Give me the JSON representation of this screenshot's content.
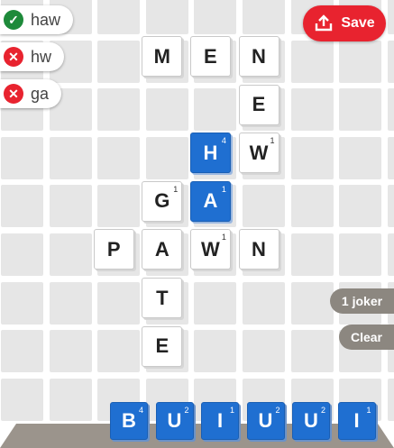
{
  "words": [
    {
      "text": "haw",
      "valid": true,
      "icon": "check-icon"
    },
    {
      "text": "hw",
      "valid": false,
      "icon": "close-icon"
    },
    {
      "text": "ga",
      "valid": false,
      "icon": "close-icon"
    }
  ],
  "save_button": {
    "label": "Save",
    "icon": "upload-tray-icon",
    "color": "#e8232f"
  },
  "board_tiles": [
    {
      "letter": "M",
      "points": "",
      "row": 0,
      "col": 3,
      "style": "placed"
    },
    {
      "letter": "E",
      "points": "",
      "row": 0,
      "col": 4,
      "style": "placed"
    },
    {
      "letter": "N",
      "points": "",
      "row": 0,
      "col": 5,
      "style": "placed"
    },
    {
      "letter": "E",
      "points": "",
      "row": 1,
      "col": 5,
      "style": "placed"
    },
    {
      "letter": "H",
      "points": "4",
      "row": 2,
      "col": 4,
      "style": "new"
    },
    {
      "letter": "W",
      "points": "1",
      "row": 2,
      "col": 5,
      "style": "placed"
    },
    {
      "letter": "G",
      "points": "1",
      "row": 3,
      "col": 3,
      "style": "placed"
    },
    {
      "letter": "A",
      "points": "1",
      "row": 3,
      "col": 4,
      "style": "new"
    },
    {
      "letter": "P",
      "points": "",
      "row": 4,
      "col": 2,
      "style": "placed"
    },
    {
      "letter": "A",
      "points": "",
      "row": 4,
      "col": 3,
      "style": "placed"
    },
    {
      "letter": "W",
      "points": "1",
      "row": 4,
      "col": 4,
      "style": "placed"
    },
    {
      "letter": "N",
      "points": "",
      "row": 4,
      "col": 5,
      "style": "placed"
    },
    {
      "letter": "T",
      "points": "",
      "row": 5,
      "col": 3,
      "style": "placed"
    },
    {
      "letter": "E",
      "points": "",
      "row": 6,
      "col": 3,
      "style": "placed"
    }
  ],
  "rack": [
    {
      "letter": "B",
      "points": "4"
    },
    {
      "letter": "U",
      "points": "2"
    },
    {
      "letter": "I",
      "points": "1"
    },
    {
      "letter": "U",
      "points": "2"
    },
    {
      "letter": "U",
      "points": "2"
    },
    {
      "letter": "I",
      "points": "1"
    }
  ],
  "joker_button": {
    "label": "1 joker"
  },
  "clear_button": {
    "label": "Clear"
  },
  "colors": {
    "new_tile": "#1f6fd1",
    "valid": "#1e8a3a",
    "invalid": "#e8232f",
    "side_button": "#8c8780"
  }
}
